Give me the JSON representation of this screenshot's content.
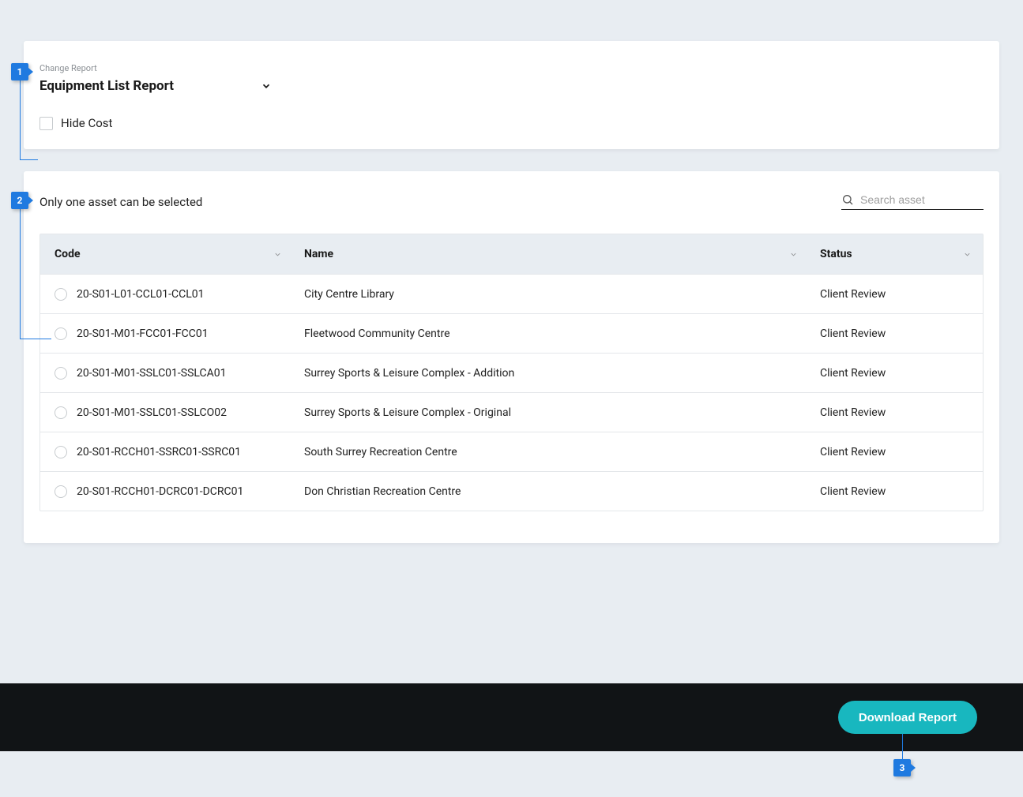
{
  "header": {
    "change_report_label": "Change Report",
    "report_title": "Equipment List Report",
    "hide_cost_label": "Hide Cost"
  },
  "main": {
    "selection_hint": "Only one asset can be selected",
    "search_placeholder": "Search asset",
    "table": {
      "columns": {
        "code": "Code",
        "name": "Name",
        "status": "Status"
      },
      "rows": [
        {
          "code": "20-S01-L01-CCL01-CCL01",
          "name": "City Centre Library",
          "status": "Client Review"
        },
        {
          "code": "20-S01-M01-FCC01-FCC01",
          "name": "Fleetwood Community Centre",
          "status": "Client Review"
        },
        {
          "code": "20-S01-M01-SSLC01-SSLCA01",
          "name": "Surrey Sports & Leisure Complex - Addition",
          "status": "Client Review"
        },
        {
          "code": "20-S01-M01-SSLC01-SSLCO02",
          "name": "Surrey Sports & Leisure Complex - Original",
          "status": "Client Review"
        },
        {
          "code": "20-S01-RCCH01-SSRC01-SSRC01",
          "name": "South Surrey Recreation Centre",
          "status": "Client Review"
        },
        {
          "code": "20-S01-RCCH01-DCRC01-DCRC01",
          "name": "Don Christian Recreation Centre",
          "status": "Client Review"
        }
      ]
    }
  },
  "footer": {
    "download_label": "Download Report"
  },
  "callouts": {
    "c1": "1",
    "c2": "2",
    "c3": "3"
  }
}
